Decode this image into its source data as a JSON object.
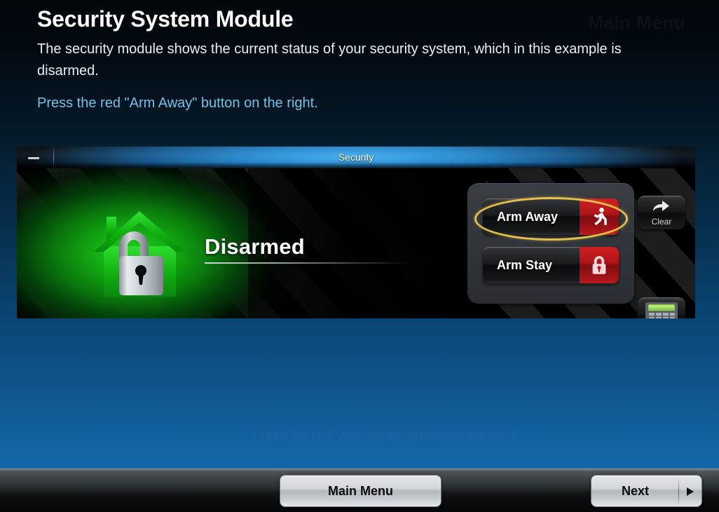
{
  "header": {
    "title": "Security System Module",
    "description": "The security module shows the current status of your security system, which in this example is disarmed.",
    "instruction": "Press the red \"Arm Away\" button on the right.",
    "instruction_color": "#72c2e8",
    "ghost_top_right": "Main Menu",
    "ghost_middle": "Press the red \"Arm Away\" button on the right."
  },
  "security_window": {
    "titlebar": {
      "title": "Security",
      "minimize_icon": "minimize-icon"
    },
    "status": {
      "label": "Disarmed",
      "icon": "house-unlocked-icon",
      "state_color": "#16c216"
    },
    "buttons": [
      {
        "label": "Arm Away",
        "icon": "running-person-icon",
        "icon_color": "#c0181c",
        "highlighted": true
      },
      {
        "label": "Arm Stay",
        "icon": "padlock-closed-icon",
        "icon_color": "#c0181c",
        "highlighted": false
      }
    ],
    "clear_button": {
      "label": "Clear",
      "icon": "undo-arrow-icon"
    },
    "keypad_button": {
      "icon": "keypad-icon",
      "screen_color": "#8fd14a"
    },
    "highlight_color": "#e3c14a"
  },
  "bottom_bar": {
    "main_menu_label": "Main Menu",
    "next_label": "Next",
    "next_icon": "chevron-right-icon"
  }
}
